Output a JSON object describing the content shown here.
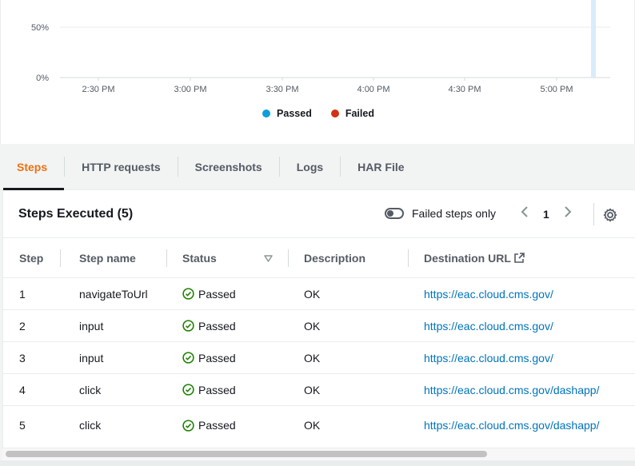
{
  "chart": {
    "y_ticks": [
      "50%",
      "0%"
    ],
    "x_ticks": [
      "2:30 PM",
      "3:00 PM",
      "3:30 PM",
      "4:00 PM",
      "4:30 PM",
      "5:00 PM"
    ],
    "legend": [
      {
        "label": "Passed",
        "color": "#0d9fd8"
      },
      {
        "label": "Failed",
        "color": "#d13212"
      }
    ]
  },
  "chart_data": {
    "type": "bar",
    "title": "",
    "xlabel": "",
    "ylabel": "",
    "y_ticks": [
      "0%",
      "50%"
    ],
    "x_ticks": [
      "2:30 PM",
      "3:00 PM",
      "3:30 PM",
      "4:00 PM",
      "4:30 PM",
      "5:00 PM"
    ],
    "series": [
      {
        "name": "Passed",
        "color": "#0d9fd8"
      },
      {
        "name": "Failed",
        "color": "#d13212"
      }
    ],
    "grid": true,
    "legend_position": "bottom-center"
  },
  "tabs": [
    {
      "label": "Steps",
      "active": true
    },
    {
      "label": "HTTP requests",
      "active": false
    },
    {
      "label": "Screenshots",
      "active": false
    },
    {
      "label": "Logs",
      "active": false
    },
    {
      "label": "HAR File",
      "active": false
    }
  ],
  "table": {
    "title": "Steps Executed (5)",
    "toggle_label": "Failed steps only",
    "page": "1",
    "columns": [
      "Step",
      "Step name",
      "Status",
      "Description",
      "Destination URL"
    ],
    "rows": [
      {
        "step": "1",
        "name": "navigateToUrl",
        "status": "Passed",
        "description": "OK",
        "url": "https://eac.cloud.cms.gov/"
      },
      {
        "step": "2",
        "name": "input",
        "status": "Passed",
        "description": "OK",
        "url": "https://eac.cloud.cms.gov/"
      },
      {
        "step": "3",
        "name": "input",
        "status": "Passed",
        "description": "OK",
        "url": "https://eac.cloud.cms.gov/"
      },
      {
        "step": "4",
        "name": "click",
        "status": "Passed",
        "description": "OK",
        "url": "https://eac.cloud.cms.gov/dashapp/"
      },
      {
        "step": "5",
        "name": "click",
        "status": "Passed",
        "description": "OK",
        "url": "https://eac.cloud.cms.gov/dashapp/"
      }
    ]
  },
  "colors": {
    "accent": "#ec7211",
    "link": "#0073bb",
    "success": "#1d8102"
  }
}
